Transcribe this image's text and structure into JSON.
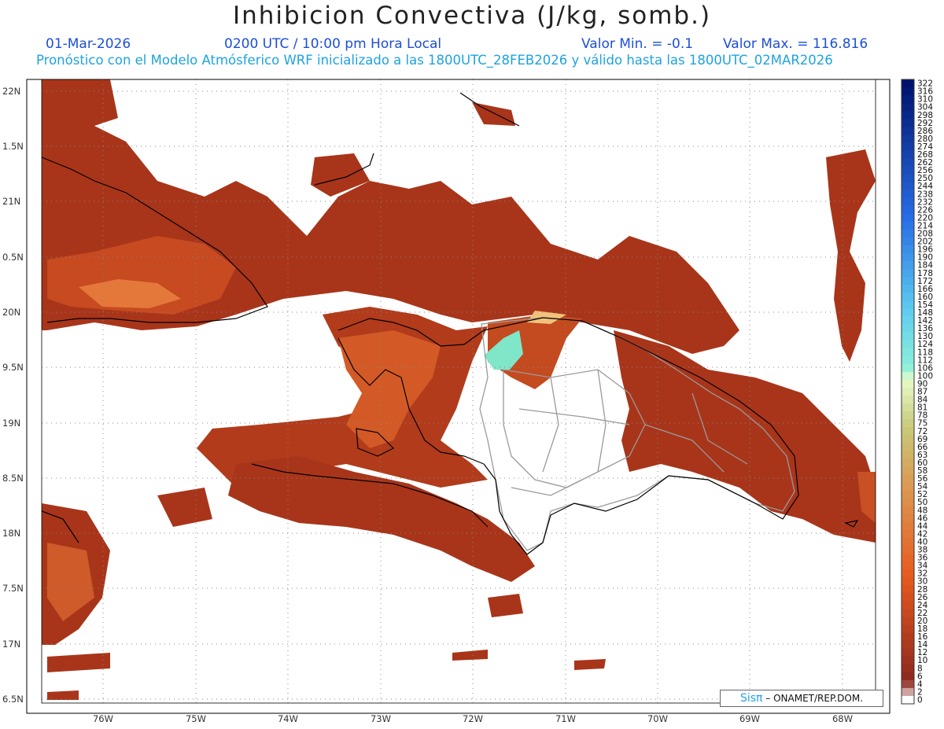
{
  "header": {
    "title": "Inhibicion Convectiva (J/kg, somb.)",
    "date": "01-Mar-2026",
    "time": "0200 UTC / 10:00 pm Hora Local",
    "min_label": "Valor Min. = -0.1",
    "max_label": "Valor Max. = 116.816",
    "forecast": "Pronóstico con el Modelo Atmósferico WRF inicializado a las 1800UTC_28FEB2026 y válido hasta las  1800UTC_02MAR2026"
  },
  "axes": {
    "lat_labels": [
      "22N",
      "1.5N",
      "21N",
      "0.5N",
      "20N",
      "9.5N",
      "19N",
      "8.5N",
      "18N",
      "7.5N",
      "17N",
      "6.5N"
    ],
    "lon_labels": [
      "76W",
      "75W",
      "74W",
      "73W",
      "72W",
      "71W",
      "70W",
      "69W",
      "68W"
    ]
  },
  "colorbar": {
    "labels": [
      "322",
      "316",
      "310",
      "304",
      "298",
      "292",
      "286",
      "280",
      "274",
      "268",
      "262",
      "256",
      "250",
      "244",
      "238",
      "232",
      "226",
      "220",
      "214",
      "208",
      "202",
      "196",
      "190",
      "184",
      "178",
      "172",
      "166",
      "160",
      "154",
      "148",
      "142",
      "136",
      "130",
      "124",
      "118",
      "112",
      "106",
      "100",
      "90",
      "87",
      "84",
      "81",
      "78",
      "75",
      "72",
      "69",
      "66",
      "63",
      "60",
      "58",
      "56",
      "54",
      "52",
      "50",
      "48",
      "46",
      "44",
      "42",
      "40",
      "38",
      "36",
      "34",
      "32",
      "30",
      "28",
      "26",
      "24",
      "22",
      "20",
      "18",
      "16",
      "14",
      "12",
      "10",
      "8",
      "6",
      "4",
      "2",
      "0"
    ]
  },
  "colors": {
    "cin_low": "#a33418",
    "cin_mid": "#c4471e",
    "cin_high": "#e0692c",
    "cin_peak": "#f2b06a",
    "cin_cyan": "#7fe6c8",
    "coast": "#000000",
    "border": "#9a9a9a",
    "grid": "#8a8a8a"
  },
  "credit": {
    "brand": "Sisπ",
    "text": " – ONAMET/REP.DOM."
  }
}
